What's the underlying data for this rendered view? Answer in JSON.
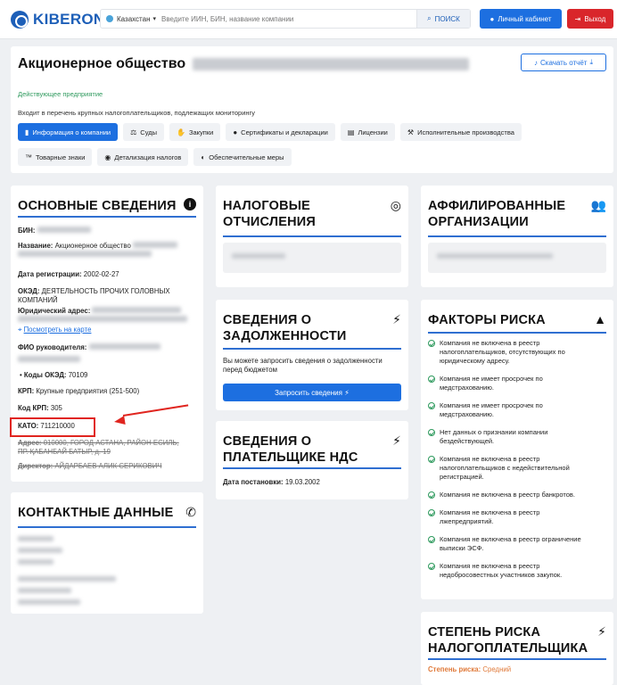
{
  "header": {
    "logo_text": "KIBERON",
    "country": "Казахстан",
    "search_placeholder": "Введите ИИН, БИН, название компании",
    "search_button": "ПОИСК",
    "cabinet_button": "Личный кабинет",
    "exit_button": "Выход"
  },
  "company": {
    "title_prefix": "Акционерное общество",
    "download_button": "Скачать отчёт",
    "status": "Действующее предприятие",
    "monitoring_note": "Входит в перечень крупных налогоплательщиков, подлежащих мониторингу",
    "tabs_row1": [
      {
        "label": "Информация о компании",
        "icon": "building-icon",
        "glyph": "▮",
        "active": true
      },
      {
        "label": "Суды",
        "icon": "scales-icon",
        "glyph": "⚖",
        "active": false
      },
      {
        "label": "Закупки",
        "icon": "handshake-icon",
        "glyph": "✋",
        "active": false
      },
      {
        "label": "Сертификаты и декларации",
        "icon": "certificate-icon",
        "glyph": "●",
        "active": false
      },
      {
        "label": "Лицензии",
        "icon": "document-icon",
        "glyph": "▤",
        "active": false
      },
      {
        "label": "Исполнительные производства",
        "icon": "hammer-icon",
        "glyph": "⚒",
        "active": false
      }
    ],
    "tabs_row2": [
      {
        "label": "Товарные знаки",
        "icon": "trademark-icon",
        "glyph": "™",
        "active": false
      },
      {
        "label": "Детализация налогов",
        "icon": "coins-icon",
        "glyph": "◉",
        "active": false
      },
      {
        "label": "Обеспечительные меры",
        "icon": "shield-icon",
        "glyph": "◐",
        "active": false
      }
    ]
  },
  "basic_info": {
    "title": "ОСНОВНЫЕ СВЕДЕНИЯ",
    "bin_label": "БИН:",
    "name_label": "Название:",
    "name_value": "Акционерное общество",
    "reg_date_label": "Дата регистрации:",
    "reg_date_value": "2002-02-27",
    "oked_label": "ОКЭД:",
    "oked_value": "ДЕЯТЕЛЬНОСТЬ ПРОЧИХ ГОЛОВНЫХ",
    "oked_value_2": "КОМПАНИЙ",
    "address_label": "Юридический адрес:",
    "map_link": "Посмотреть на карте",
    "head_label": "ФИО руководителя:",
    "oked_codes_label": "Коды ОКЭД:",
    "oked_codes_value": "70109",
    "krp_label": "КРП:",
    "krp_value": "Крупные предприятия (251-500)",
    "krp_code_label": "Код КРП:",
    "krp_code_value": "305",
    "kato_label": "КАТО:",
    "kato_value": "711210000",
    "old_address_label": "Адрес:",
    "old_address_value": "010000, ГОРОД АСТАНА, РАЙОН ЕСИЛЬ,",
    "old_address_value_2": "ПР. ҚАБАНБАЙ БАТЫР, д. 19",
    "old_director_label": "Директор:",
    "old_director_value": "АЙДАРБАЕВ АЛИК СЕРИКОВИЧ"
  },
  "contacts": {
    "title": "КОНТАКТНЫЕ ДАННЫЕ"
  },
  "tax": {
    "title_1": "НАЛОГОВЫЕ",
    "title_2": "ОТЧИСЛЕНИЯ"
  },
  "debt": {
    "title_1": "СВЕДЕНИЯ О",
    "title_2": "ЗАДОЛЖЕННОСТИ",
    "note_1": "Вы можете запросить сведения о задолженности",
    "note_2": "перед бюджетом",
    "button": "Запросить сведения ⚡"
  },
  "vat": {
    "title_1": "СВЕДЕНИЯ О",
    "title_2": "ПЛАТЕЛЬЩИКЕ НДС",
    "date_label": "Дата постановки:",
    "date_value": "19.03.2002"
  },
  "affiliated": {
    "title_1": "АФФИЛИРОВАННЫЕ",
    "title_2": "ОРГАНИЗАЦИИ"
  },
  "risk_factors": {
    "title": "ФАКТОРЫ РИСКА",
    "items": [
      [
        "Компания не включена в реестр",
        "налогоплательщиков, отсутствующих по",
        "юридическому адресу."
      ],
      [
        "Компания не имеет просрочек по",
        "медстрахованию."
      ],
      [
        "Компания не имеет просрочек по",
        "медстрахованию."
      ],
      [
        "Нет данных о признании компании",
        "бездействующей."
      ],
      [
        "Компания не включена в реестр",
        "налогоплательщиков с недействительной",
        "регистрацией."
      ],
      [
        "Компания не включена в реестр банкротов."
      ],
      [
        "Компания не включена в реестр",
        "лжепредприятий."
      ],
      [
        "Компания не включена в реестр ограничение",
        "выписки ЭСФ."
      ],
      [
        "Компания не включена в реестр",
        "недобросовестных участников закупок."
      ]
    ]
  },
  "risk_degree": {
    "title_1": "СТЕПЕНЬ РИСКА",
    "title_2": "НАЛОГОПЛАТЕЛЬЩИКА",
    "label": "Степень риска:",
    "value": "Средний"
  },
  "colors": {
    "brand": "#1d5fb8",
    "primary": "#1d6fe0",
    "danger": "#d9262b",
    "success": "#2f9a5e",
    "highlight": "#e0251f",
    "risk_medium": "#e07a3a"
  }
}
